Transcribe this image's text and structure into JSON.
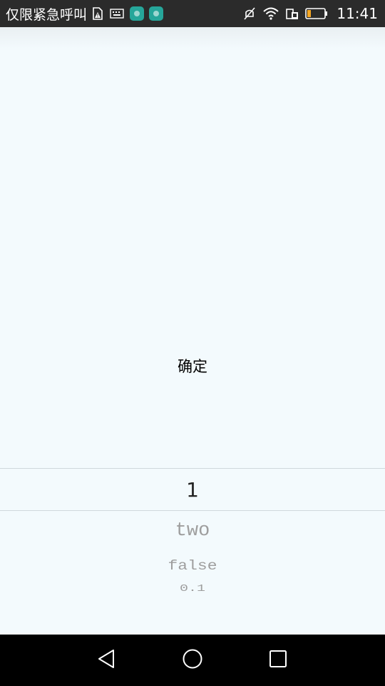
{
  "status_bar": {
    "carrier_text": "仅限紧急呼叫",
    "time": "11:41",
    "icons": [
      "sim-card-warning-icon",
      "keyboard-icon",
      "huawei-app-icon",
      "huawei-app-icon",
      "mute-icon",
      "wifi-icon",
      "dual-sim-icon",
      "battery-low-icon"
    ],
    "colors": {
      "background": "#2b2b2b",
      "app_icon": "#26a69a",
      "battery_level": "#f5a623"
    }
  },
  "main": {
    "confirm_label": "确定",
    "background": "#f3fafd"
  },
  "picker": {
    "selected": "1",
    "items_below": [
      "two",
      "false",
      "0.1"
    ]
  },
  "nav_bar": {
    "icons": [
      "back-icon",
      "home-icon",
      "recent-apps-icon"
    ]
  }
}
